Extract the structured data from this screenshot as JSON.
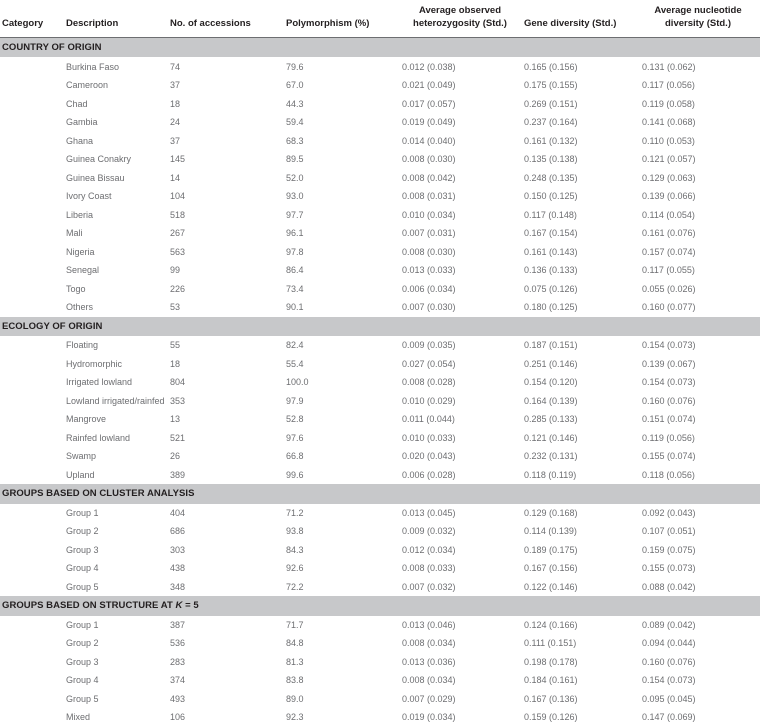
{
  "table": {
    "columns": [
      {
        "key": "category",
        "label": "Category",
        "align": "left"
      },
      {
        "key": "description",
        "label": "Description",
        "align": "left"
      },
      {
        "key": "accessions",
        "label": "No. of accessions",
        "align": "left"
      },
      {
        "key": "polymorphism",
        "label": "Polymorphism (%)",
        "align": "left"
      },
      {
        "key": "heterozygosity",
        "label": "Average observed heterozygosity (Std.)",
        "align": "center"
      },
      {
        "key": "gene_diversity",
        "label": "Gene diversity (Std.)",
        "align": "center"
      },
      {
        "key": "nucleotide_diversity",
        "label": "Average nucleotide diversity (Std.)",
        "align": "center"
      }
    ],
    "header_lines": {
      "category": [
        "Category"
      ],
      "description": [
        "Description"
      ],
      "accessions": [
        "No. of accessions"
      ],
      "polymorphism": [
        "Polymorphism (%)"
      ],
      "heterozygosity": [
        "Average observed",
        "heterozygosity (Std.)"
      ],
      "gene_diversity": [
        "Gene diversity (Std.)"
      ],
      "nucleotide_diversity": [
        "Average nucleotide",
        "diversity (Std.)"
      ]
    },
    "sections": [
      {
        "title": "COUNTRY OF ORIGIN",
        "title_has_italic_k": false,
        "rows": [
          {
            "description": "Burkina Faso",
            "accessions": "74",
            "polymorphism": "79.6",
            "heterozygosity": "0.012 (0.038)",
            "gene_diversity": "0.165 (0.156)",
            "nucleotide_diversity": "0.131 (0.062)"
          },
          {
            "description": "Cameroon",
            "accessions": "37",
            "polymorphism": "67.0",
            "heterozygosity": "0.021 (0.049)",
            "gene_diversity": "0.175 (0.155)",
            "nucleotide_diversity": "0.117 (0.056)"
          },
          {
            "description": "Chad",
            "accessions": "18",
            "polymorphism": "44.3",
            "heterozygosity": "0.017 (0.057)",
            "gene_diversity": "0.269 (0.151)",
            "nucleotide_diversity": "0.119 (0.058)"
          },
          {
            "description": "Gambia",
            "accessions": "24",
            "polymorphism": "59.4",
            "heterozygosity": "0.019 (0.049)",
            "gene_diversity": "0.237 (0.164)",
            "nucleotide_diversity": "0.141 (0.068)"
          },
          {
            "description": "Ghana",
            "accessions": "37",
            "polymorphism": "68.3",
            "heterozygosity": "0.014 (0.040)",
            "gene_diversity": "0.161 (0.132)",
            "nucleotide_diversity": "0.110 (0.053)"
          },
          {
            "description": "Guinea Conakry",
            "accessions": "145",
            "polymorphism": "89.5",
            "heterozygosity": "0.008 (0.030)",
            "gene_diversity": "0.135 (0.138)",
            "nucleotide_diversity": "0.121 (0.057)"
          },
          {
            "description": "Guinea Bissau",
            "accessions": "14",
            "polymorphism": "52.0",
            "heterozygosity": "0.008 (0.042)",
            "gene_diversity": "0.248 (0.135)",
            "nucleotide_diversity": "0.129 (0.063)"
          },
          {
            "description": "Ivory Coast",
            "accessions": "104",
            "polymorphism": "93.0",
            "heterozygosity": "0.008 (0.031)",
            "gene_diversity": "0.150 (0.125)",
            "nucleotide_diversity": "0.139 (0.066)"
          },
          {
            "description": "Liberia",
            "accessions": "518",
            "polymorphism": "97.7",
            "heterozygosity": "0.010 (0.034)",
            "gene_diversity": "0.117 (0.148)",
            "nucleotide_diversity": "0.114 (0.054)"
          },
          {
            "description": "Mali",
            "accessions": "267",
            "polymorphism": "96.1",
            "heterozygosity": "0.007 (0.031)",
            "gene_diversity": "0.167 (0.154)",
            "nucleotide_diversity": "0.161 (0.076)"
          },
          {
            "description": "Nigeria",
            "accessions": "563",
            "polymorphism": "97.8",
            "heterozygosity": "0.008 (0.030)",
            "gene_diversity": "0.161 (0.143)",
            "nucleotide_diversity": "0.157 (0.074)"
          },
          {
            "description": "Senegal",
            "accessions": "99",
            "polymorphism": "86.4",
            "heterozygosity": "0.013 (0.033)",
            "gene_diversity": "0.136 (0.133)",
            "nucleotide_diversity": "0.117 (0.055)"
          },
          {
            "description": "Togo",
            "accessions": "226",
            "polymorphism": "73.4",
            "heterozygosity": "0.006 (0.034)",
            "gene_diversity": "0.075 (0.126)",
            "nucleotide_diversity": "0.055 (0.026)"
          },
          {
            "description": "Others",
            "accessions": "53",
            "polymorphism": "90.1",
            "heterozygosity": "0.007 (0.030)",
            "gene_diversity": "0.180 (0.125)",
            "nucleotide_diversity": "0.160 (0.077)"
          }
        ]
      },
      {
        "title": "ECOLOGY OF ORIGIN",
        "title_has_italic_k": false,
        "rows": [
          {
            "description": "Floating",
            "accessions": "55",
            "polymorphism": "82.4",
            "heterozygosity": "0.009 (0.035)",
            "gene_diversity": "0.187 (0.151)",
            "nucleotide_diversity": "0.154 (0.073)"
          },
          {
            "description": "Hydromorphic",
            "accessions": "18",
            "polymorphism": "55.4",
            "heterozygosity": "0.027 (0.054)",
            "gene_diversity": "0.251 (0.146)",
            "nucleotide_diversity": "0.139 (0.067)"
          },
          {
            "description": "Irrigated lowland",
            "accessions": "804",
            "polymorphism": "100.0",
            "heterozygosity": "0.008 (0.028)",
            "gene_diversity": "0.154 (0.120)",
            "nucleotide_diversity": "0.154 (0.073)"
          },
          {
            "description": "Lowland irrigated/rainfed",
            "accessions": "353",
            "polymorphism": "97.9",
            "heterozygosity": "0.010 (0.029)",
            "gene_diversity": "0.164 (0.139)",
            "nucleotide_diversity": "0.160 (0.076)",
            "wrap": true
          },
          {
            "description": "Mangrove",
            "accessions": "13",
            "polymorphism": "52.8",
            "heterozygosity": "0.011 (0.044)",
            "gene_diversity": "0.285 (0.133)",
            "nucleotide_diversity": "0.151 (0.074)"
          },
          {
            "description": "Rainfed lowland",
            "accessions": "521",
            "polymorphism": "97.6",
            "heterozygosity": "0.010 (0.033)",
            "gene_diversity": "0.121 (0.146)",
            "nucleotide_diversity": "0.119 (0.056)"
          },
          {
            "description": "Swamp",
            "accessions": "26",
            "polymorphism": "66.8",
            "heterozygosity": "0.020 (0.043)",
            "gene_diversity": "0.232 (0.131)",
            "nucleotide_diversity": "0.155 (0.074)"
          },
          {
            "description": "Upland",
            "accessions": "389",
            "polymorphism": "99.6",
            "heterozygosity": "0.006 (0.028)",
            "gene_diversity": "0.118 (0.119)",
            "nucleotide_diversity": "0.118 (0.056)"
          }
        ]
      },
      {
        "title": "GROUPS BASED ON CLUSTER ANALYSIS",
        "title_has_italic_k": false,
        "rows": [
          {
            "description": "Group 1",
            "accessions": "404",
            "polymorphism": "71.2",
            "heterozygosity": "0.013 (0.045)",
            "gene_diversity": "0.129 (0.168)",
            "nucleotide_diversity": "0.092 (0.043)"
          },
          {
            "description": "Group 2",
            "accessions": "686",
            "polymorphism": "93.8",
            "heterozygosity": "0.009 (0.032)",
            "gene_diversity": "0.114 (0.139)",
            "nucleotide_diversity": "0.107 (0.051)"
          },
          {
            "description": "Group 3",
            "accessions": "303",
            "polymorphism": "84.3",
            "heterozygosity": "0.012 (0.034)",
            "gene_diversity": "0.189 (0.175)",
            "nucleotide_diversity": "0.159 (0.075)"
          },
          {
            "description": "Group 4",
            "accessions": "438",
            "polymorphism": "92.6",
            "heterozygosity": "0.008 (0.033)",
            "gene_diversity": "0.167 (0.156)",
            "nucleotide_diversity": "0.155 (0.073)"
          },
          {
            "description": "Group 5",
            "accessions": "348",
            "polymorphism": "72.2",
            "heterozygosity": "0.007 (0.032)",
            "gene_diversity": "0.122 (0.146)",
            "nucleotide_diversity": "0.088 (0.042)"
          }
        ]
      },
      {
        "title": "GROUPS BASED ON STRUCTURE AT K = 5",
        "title_prefix": "GROUPS BASED ON STRUCTURE AT ",
        "title_italic": "K",
        "title_suffix": " = 5",
        "title_has_italic_k": true,
        "rows": [
          {
            "description": "Group 1",
            "accessions": "387",
            "polymorphism": "71.7",
            "heterozygosity": "0.013 (0.046)",
            "gene_diversity": "0.124 (0.166)",
            "nucleotide_diversity": "0.089 (0.042)"
          },
          {
            "description": "Group 2",
            "accessions": "536",
            "polymorphism": "84.8",
            "heterozygosity": "0.008 (0.034)",
            "gene_diversity": "0.111 (0.151)",
            "nucleotide_diversity": "0.094 (0.044)"
          },
          {
            "description": "Group 3",
            "accessions": "283",
            "polymorphism": "81.3",
            "heterozygosity": "0.013 (0.036)",
            "gene_diversity": "0.198 (0.178)",
            "nucleotide_diversity": "0.160 (0.076)"
          },
          {
            "description": "Group 4",
            "accessions": "374",
            "polymorphism": "83.8",
            "heterozygosity": "0.008 (0.034)",
            "gene_diversity": "0.184 (0.161)",
            "nucleotide_diversity": "0.154 (0.073)"
          },
          {
            "description": "Group 5",
            "accessions": "493",
            "polymorphism": "89.0",
            "heterozygosity": "0.007 (0.029)",
            "gene_diversity": "0.167 (0.136)",
            "nucleotide_diversity": "0.095 (0.045)"
          },
          {
            "description": "Mixed",
            "accessions": "106",
            "polymorphism": "92.3",
            "heterozygosity": "0.019 (0.034)",
            "gene_diversity": "0.159 (0.126)",
            "nucleotide_diversity": "0.147 (0.069)"
          }
        ]
      }
    ]
  },
  "colors": {
    "section_band": "#c7c8ca",
    "header_text": "#231f20",
    "body_text": "#6d6e71",
    "header_rule": "#6d6e71",
    "background": "#ffffff"
  }
}
